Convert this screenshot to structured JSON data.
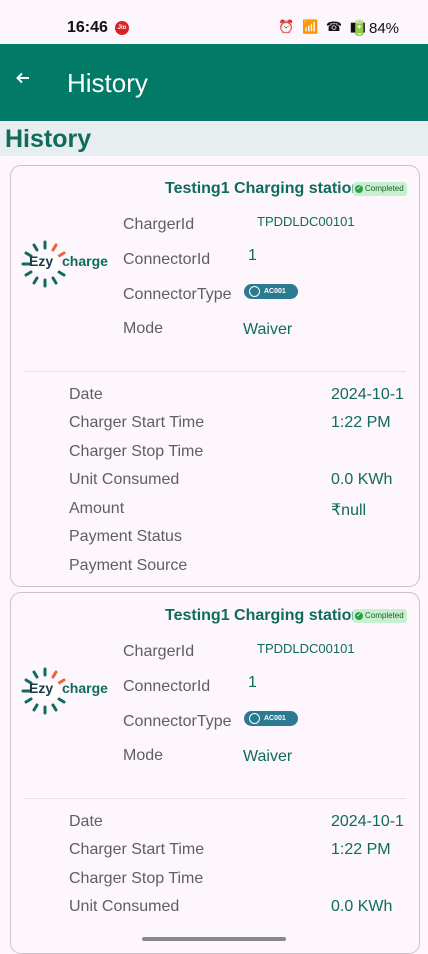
{
  "status_bar": {
    "time": "16:46",
    "carrier_badge": "Jio",
    "icons": "⏰ 📶 ☎ ▮▮",
    "battery": "🔋84%"
  },
  "app_bar": {
    "title": "History",
    "back_icon": "arrow-left-icon"
  },
  "section_title": "History",
  "labels": {
    "charger_id": "ChargerId",
    "connector_id": "ConnectorId",
    "connector_type": "ConnectorType",
    "mode": "Mode",
    "date": "Date",
    "start_time": "Charger Start Time",
    "stop_time": "Charger Stop Time",
    "unit_consumed": "Unit Consumed",
    "amount": "Amount",
    "payment_status": "Payment Status",
    "payment_source": "Payment Source"
  },
  "logo": {
    "text_ezy": "Ezy",
    "text_charge": "charge"
  },
  "colors": {
    "primary": "#017a67",
    "text_green": "#0f6b5b",
    "badge_bg": "#c8f0d0",
    "connector_chip": "#2b7a91"
  },
  "records": [
    {
      "station": "Testing1 Charging station",
      "status": "Completed",
      "charger_id": "TPDDLDC00101",
      "connector_id": "1",
      "connector_type": "AC001",
      "mode": "Waiver",
      "date": "2024-10-1",
      "start_time": "1:22 PM",
      "stop_time": "",
      "unit_consumed": "0.0 KWh",
      "amount": "₹null",
      "payment_status": "",
      "payment_source": ""
    },
    {
      "station": "Testing1 Charging station",
      "status": "Completed",
      "charger_id": "TPDDLDC00101",
      "connector_id": "1",
      "connector_type": "AC001",
      "mode": "Waiver",
      "date": "2024-10-1",
      "start_time": "1:22 PM",
      "stop_time": "",
      "unit_consumed": "0.0 KWh"
    }
  ]
}
